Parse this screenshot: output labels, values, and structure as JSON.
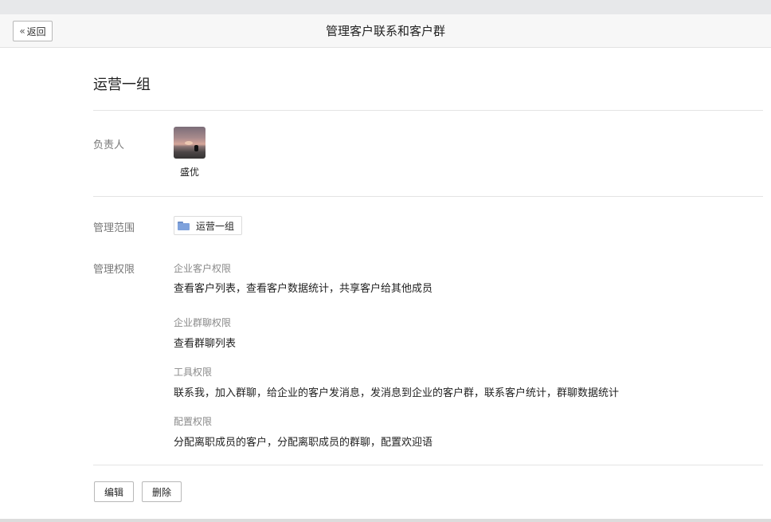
{
  "header": {
    "back_label": "返回",
    "title": "管理客户联系和客户群"
  },
  "group": {
    "name": "运营一组"
  },
  "owner": {
    "label": "负责人",
    "name": "盛优"
  },
  "scope": {
    "label": "管理范围",
    "tag": "运营一组"
  },
  "permissions": {
    "label": "管理权限",
    "sections": [
      {
        "title": "企业客户权限",
        "value": "查看客户列表，查看客户数据统计，共享客户给其他成员"
      },
      {
        "title": "企业群聊权限",
        "value": "查看群聊列表"
      },
      {
        "title": "工具权限",
        "value": "联系我，加入群聊，给企业的客户发消息，发消息到企业的客户群，联系客户统计，群聊数据统计"
      },
      {
        "title": "配置权限",
        "value": "分配离职成员的客户，分配离职成员的群聊，配置欢迎语"
      }
    ]
  },
  "actions": {
    "edit_label": "编辑",
    "delete_label": "删除"
  }
}
